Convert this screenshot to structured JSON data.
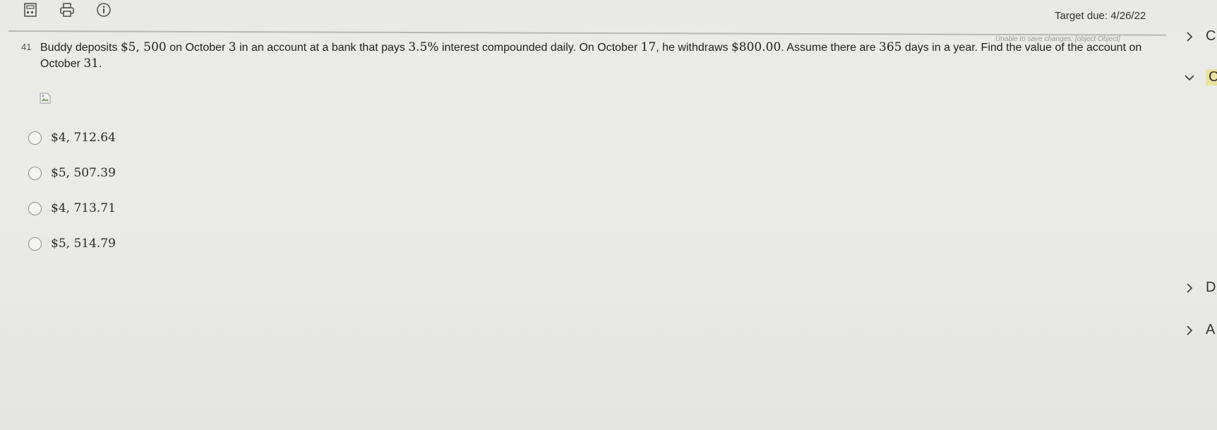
{
  "toolbar": {
    "items": [
      "calculator-icon",
      "print-icon",
      "info-icon"
    ]
  },
  "header": {
    "target_due": "Target due: 4/26/22",
    "save_error": "Unable to save changes: [object Object]"
  },
  "question": {
    "number": "41",
    "text_parts": [
      "Buddy deposits ",
      "$5, 500",
      " on October ",
      "3",
      " in an account at a bank that pays ",
      "3.5%",
      " interest compounded daily. On October ",
      "17",
      ", he withdraws ",
      "$800.00",
      ". Assume there are ",
      "365",
      " days in a year. Find the value of the account on October ",
      "31",
      "."
    ],
    "choices": [
      "$4, 712.64",
      "$5, 507.39",
      "$4, 713.71",
      "$5, 514.79"
    ]
  },
  "side_panel": {
    "items": [
      "C",
      "C",
      "D",
      "A"
    ]
  }
}
